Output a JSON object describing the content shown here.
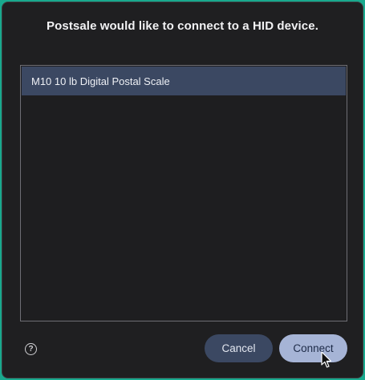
{
  "dialog": {
    "title": "Postsale would like to connect to a HID device."
  },
  "devices": [
    {
      "label": "M10 10 lb Digital Postal Scale",
      "selected": true
    }
  ],
  "footer": {
    "help_icon": "help-circle-icon",
    "help_glyph": "?",
    "cancel_label": "Cancel",
    "connect_label": "Connect"
  },
  "colors": {
    "page_background": "#19a98e",
    "dialog_background": "#1f1f21",
    "selected_row": "#3b4862",
    "cancel_button": "#3b4862",
    "connect_button": "#a6b4d6"
  }
}
